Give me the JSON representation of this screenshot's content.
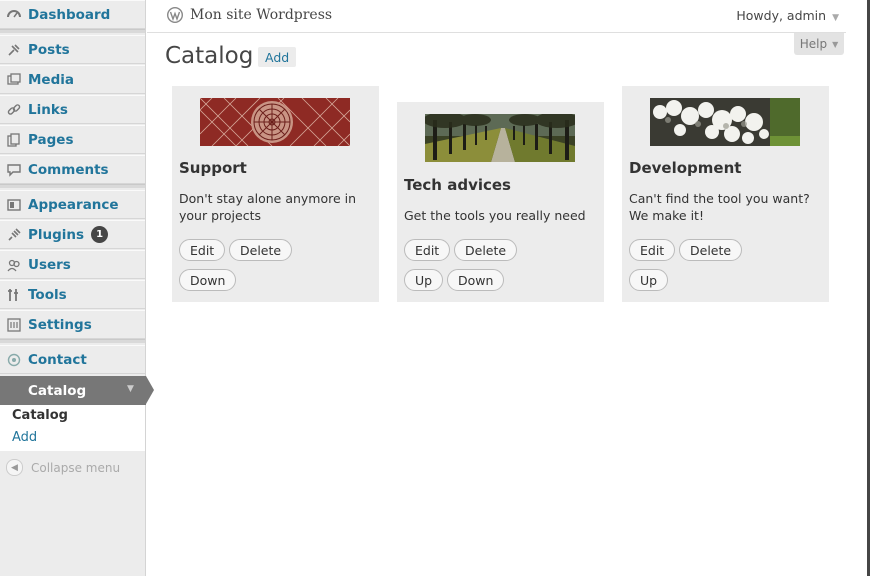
{
  "sidebar": {
    "items": [
      {
        "label": "Dashboard",
        "icon": "dashboard-icon"
      },
      {
        "label": "Posts",
        "icon": "pin-icon"
      },
      {
        "label": "Media",
        "icon": "media-icon"
      },
      {
        "label": "Links",
        "icon": "link-icon"
      },
      {
        "label": "Pages",
        "icon": "pages-icon"
      },
      {
        "label": "Comments",
        "icon": "comment-icon"
      },
      {
        "label": "Appearance",
        "icon": "appearance-icon"
      },
      {
        "label": "Plugins",
        "icon": "plugin-icon",
        "badge": "1"
      },
      {
        "label": "Users",
        "icon": "users-icon"
      },
      {
        "label": "Tools",
        "icon": "tools-icon"
      },
      {
        "label": "Settings",
        "icon": "settings-icon"
      },
      {
        "label": "Contact",
        "icon": "contact-icon"
      }
    ],
    "active": {
      "label": "Catalog"
    },
    "submenu": [
      {
        "label": "Catalog"
      },
      {
        "label": "Add"
      }
    ],
    "collapse_label": "Collapse menu"
  },
  "header": {
    "site_title": "Mon site Wordpress",
    "howdy": "Howdy, admin",
    "help": "Help"
  },
  "page": {
    "title": "Catalog",
    "add_label": "Add"
  },
  "cards": [
    {
      "title": "Support",
      "description": "Don't stay alone anymore in your projects",
      "buttons": [
        "Edit",
        "Delete",
        "Down"
      ]
    },
    {
      "title": "Tech advices",
      "description": "Get the tools you really need",
      "buttons": [
        "Edit",
        "Delete",
        "Up",
        "Down"
      ]
    },
    {
      "title": "Development",
      "description": "Can't find the tool you want? We make it!",
      "buttons": [
        "Edit",
        "Delete",
        "Up"
      ]
    }
  ],
  "colors": {
    "link_blue": "#21759b",
    "sidebar_bg": "#ececec",
    "active_menu_bg": "#777777",
    "card_bg": "#ececec"
  }
}
